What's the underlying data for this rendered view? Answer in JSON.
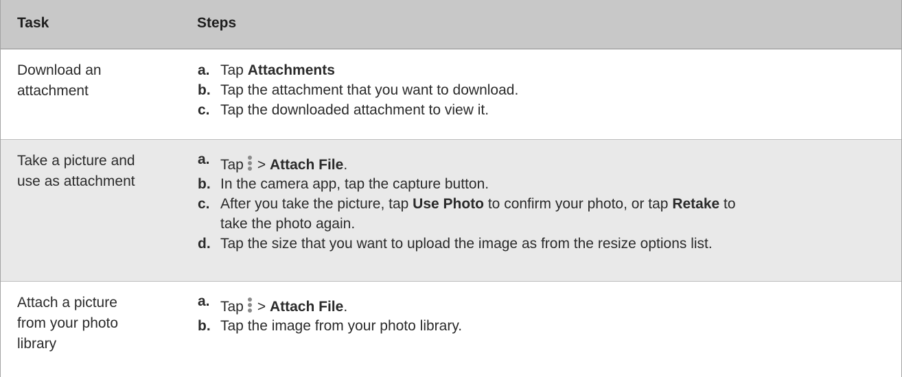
{
  "header": {
    "task": "Task",
    "steps": "Steps"
  },
  "rows": [
    {
      "task_line1": "Download an",
      "task_line2": "attachment",
      "steps": [
        {
          "letter": "a.",
          "pre": "Tap ",
          "bold": "Attachments",
          "post": ""
        },
        {
          "letter": "b.",
          "text": "Tap the attachment that you want to download."
        },
        {
          "letter": "c.",
          "text": "Tap the downloaded attachment to view it."
        }
      ]
    },
    {
      "task_line1": "Take a picture and",
      "task_line2": "use as attachment",
      "steps": [
        {
          "letter": "a.",
          "pre": "Tap",
          "sep": ">",
          "bold": "Attach File",
          "post": "."
        },
        {
          "letter": "b.",
          "text": "In the camera app, tap the capture button."
        },
        {
          "letter": "c.",
          "pre": "After you take the picture, tap ",
          "bold1": "Use Photo",
          "mid": " to confirm your photo, or tap ",
          "bold2": "Retake",
          "post1": " to",
          "line2": "take the photo again."
        },
        {
          "letter": "d.",
          "text": "Tap the size that you want to upload the image as from the resize options list."
        }
      ]
    },
    {
      "task_line1": "Attach a picture",
      "task_line2": "from your photo",
      "task_line3": "library",
      "steps": [
        {
          "letter": "a.",
          "pre": "Tap",
          "sep": ">",
          "bold": "Attach File",
          "post": "."
        },
        {
          "letter": "b.",
          "text": "Tap the image from your photo library."
        }
      ]
    }
  ],
  "icons": {
    "menu": "vertical-ellipsis-icon"
  }
}
